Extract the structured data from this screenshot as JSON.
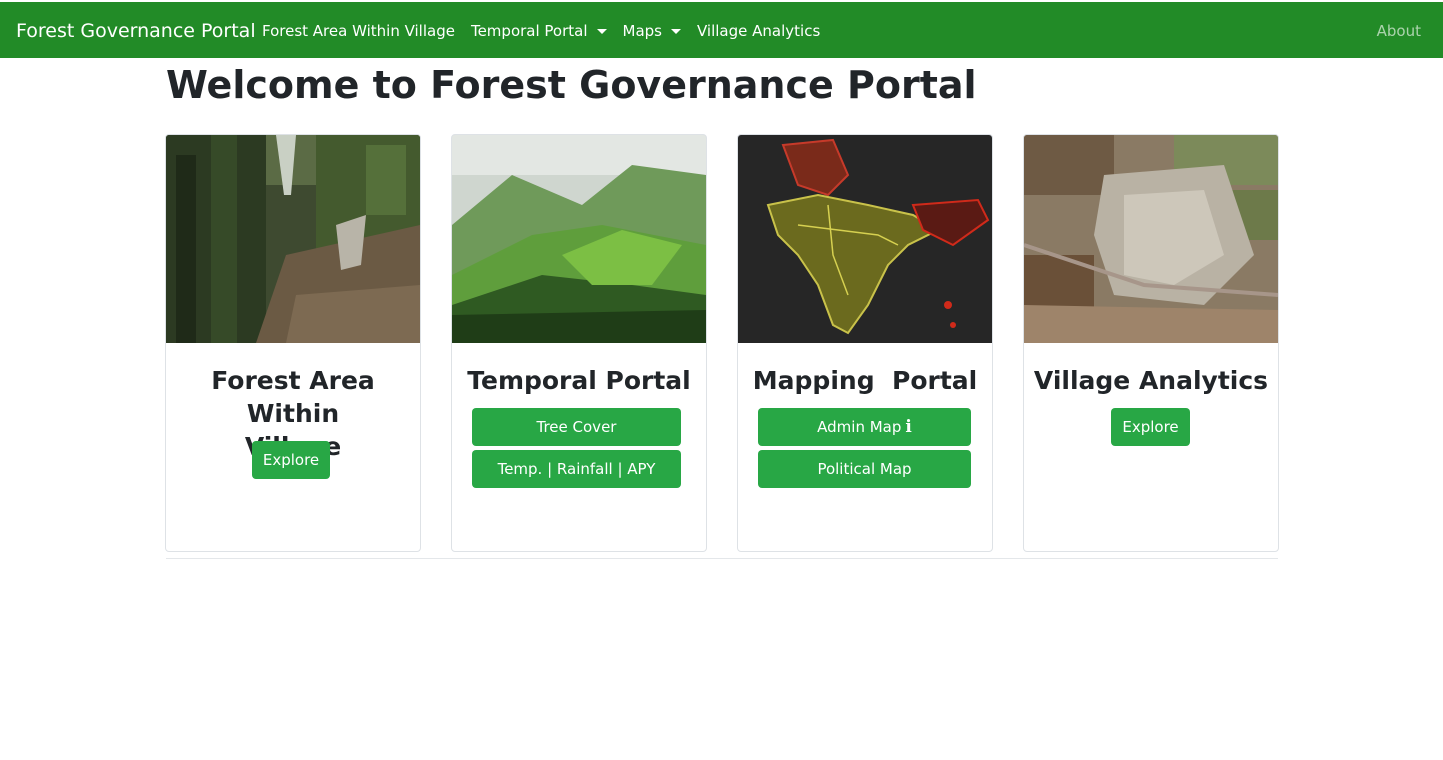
{
  "navbar": {
    "brand": "Forest Governance Portal",
    "links": [
      {
        "label": "Forest Area Within Village",
        "dropdown": false
      },
      {
        "label": "Temporal Portal",
        "dropdown": true
      },
      {
        "label": "Maps",
        "dropdown": true
      },
      {
        "label": "Village Analytics",
        "dropdown": false
      }
    ],
    "about": "About"
  },
  "page": {
    "title": "Welcome to Forest Governance Portal"
  },
  "cards": [
    {
      "title": "Forest Area Within Village",
      "buttons": [
        {
          "label": "Explore"
        }
      ]
    },
    {
      "title": "Temporal Portal",
      "buttons": [
        {
          "label": "Tree Cover"
        },
        {
          "label": "Temp. | Rainfall | APY"
        }
      ]
    },
    {
      "title": "Mapping  Portal",
      "buttons": [
        {
          "label": "Admin Map",
          "icon": "info-icon"
        },
        {
          "label": "Political Map"
        }
      ]
    },
    {
      "title": "Village Analytics",
      "buttons": [
        {
          "label": "Explore"
        }
      ]
    }
  ],
  "colors": {
    "navbar": "#228b27",
    "button": "#28a745",
    "text": "#212529"
  }
}
